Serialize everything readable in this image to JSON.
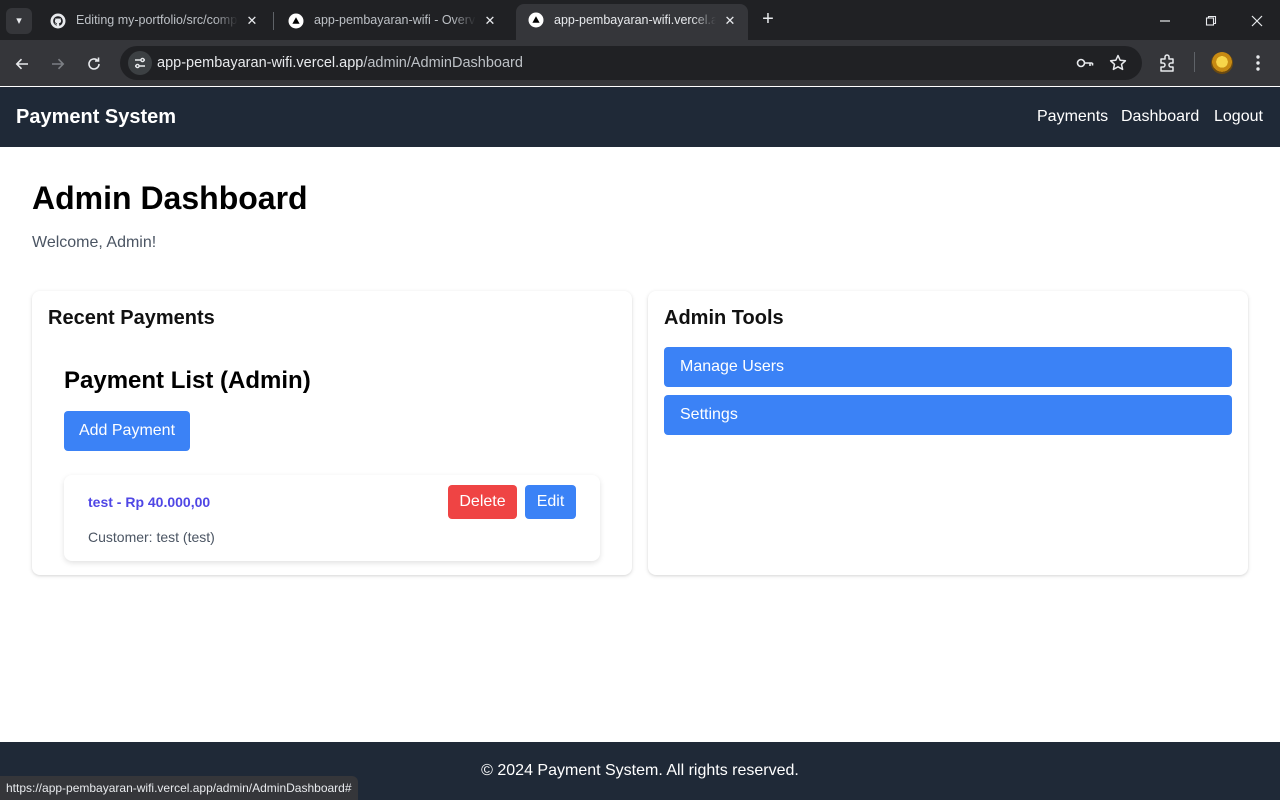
{
  "browser": {
    "tabs": [
      {
        "title": "Editing my-portfolio/src/components",
        "favicon": "github-icon",
        "active": false
      },
      {
        "title": "app-pembayaran-wifi - Overview",
        "favicon": "vercel-icon",
        "active": false
      },
      {
        "title": "app-pembayaran-wifi.vercel.app",
        "favicon": "vercel-icon",
        "active": true
      }
    ],
    "url_domain": "app-pembayaran-wifi.vercel.app",
    "url_path": "/admin/AdminDashboard",
    "status_url": "https://app-pembayaran-wifi.vercel.app/admin/AdminDashboard#"
  },
  "header": {
    "brand": "Payment System",
    "nav": [
      "Payments",
      "Dashboard",
      "Logout"
    ],
    "background": "#1f2937"
  },
  "main": {
    "title": "Admin Dashboard",
    "welcome": "Welcome, Admin!"
  },
  "recent_payments": {
    "title": "Recent Payments",
    "list_title": "Payment List (Admin)",
    "add_label": "Add Payment",
    "items": [
      {
        "name_amount": "test - Rp 40.000,00",
        "customer": "Customer: test (test)",
        "delete_label": "Delete",
        "edit_label": "Edit"
      }
    ]
  },
  "admin_tools": {
    "title": "Admin Tools",
    "buttons": [
      "Manage Users",
      "Settings"
    ]
  },
  "footer": {
    "text": "© 2024 Payment System. All rights reserved."
  },
  "colors": {
    "primary": "#3b82f6",
    "danger": "#ef4444",
    "link": "#4f46e5",
    "dark": "#1f2937"
  }
}
